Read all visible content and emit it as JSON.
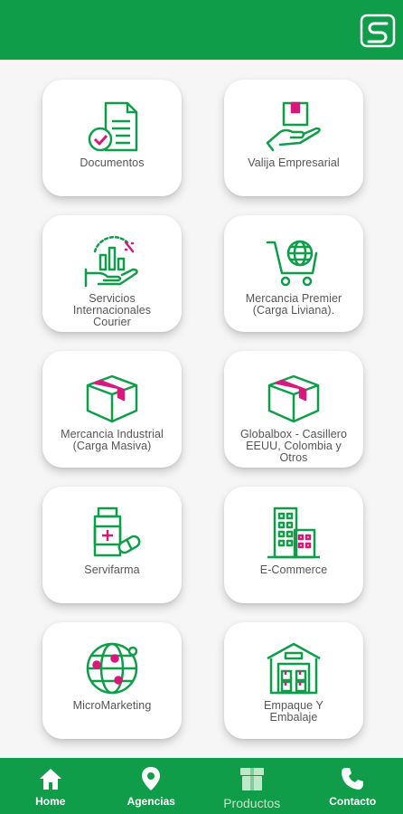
{
  "app": {
    "colors": {
      "brand_green": "#0f9d4a",
      "accent_pink": "#d6197a"
    },
    "logo_icon": "s-logo-icon"
  },
  "products": [
    {
      "label": "Documentos",
      "icon": "document-check-icon"
    },
    {
      "label": "Valija Empresarial",
      "icon": "box-in-hand-icon"
    },
    {
      "label": "Servicios\nInternacionales\nCourier",
      "icon": "growth-chart-hand-icon"
    },
    {
      "label": "Mercancia Premier\n(Carga Liviana).",
      "icon": "globe-cart-icon"
    },
    {
      "label": "Mercancia Industrial\n(Carga Masiva)",
      "icon": "box-icon"
    },
    {
      "label": "Globalbox - Casillero\nEEUU, Colombia y\nOtros",
      "icon": "box-icon"
    },
    {
      "label": "Servifarma",
      "icon": "medicine-bottle-icon"
    },
    {
      "label": "E-Commerce",
      "icon": "buildings-icon"
    },
    {
      "label": "MicroMarketing",
      "icon": "network-globe-icon"
    },
    {
      "label": "Empaque Y\nEmbalaje",
      "icon": "warehouse-icon"
    }
  ],
  "nav": {
    "items": [
      {
        "label": "Home",
        "icon": "home-icon"
      },
      {
        "label": "Agencias",
        "icon": "location-pin-icon"
      },
      {
        "label": "Productos",
        "icon": "products-box-icon",
        "active": true
      },
      {
        "label": "Contacto",
        "icon": "phone-icon"
      }
    ]
  }
}
